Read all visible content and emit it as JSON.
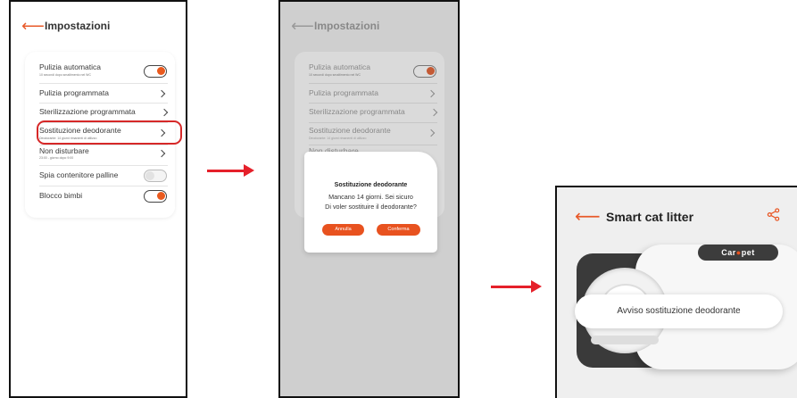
{
  "settings": {
    "title": "Impostazioni",
    "items": [
      {
        "label": "Pulizia automatica",
        "sub": "10 secondi dopo smaltimento nel WC",
        "control": "toggle-on"
      },
      {
        "label": "Pulizia programmata",
        "sub": "",
        "control": "chevron"
      },
      {
        "label": "Sterilizzazione programmata",
        "sub": "",
        "control": "chevron"
      },
      {
        "label": "Sostituzione deodorante",
        "sub": "Deodorante: 14 giorni rimanenti di utilizzo",
        "control": "chevron"
      },
      {
        "label": "Non disturbare",
        "sub": "23:00 - giorno dopo 9:00",
        "control": "chevron"
      },
      {
        "label": "Spia contenitore palline",
        "sub": "",
        "control": "toggle-off"
      },
      {
        "label": "Blocco bimbi",
        "sub": "",
        "control": "toggle-on"
      }
    ]
  },
  "dialog": {
    "title": "Sostituzione deodorante",
    "message_line1": "Mancano 14 giorni. Sei sicuro",
    "message_line2": "Di voler sostituire il deodorante?",
    "cancel_label": "Annulla",
    "confirm_label": "Conferma"
  },
  "device": {
    "title": "Smart cat litter",
    "brand": "Carepet",
    "brand_prefix": "Car",
    "brand_suffix": "pet",
    "notice": "Avviso sostituzione deodorante"
  },
  "colors": {
    "accent": "#e8521f",
    "highlight": "#d62828",
    "arrow": "#e5202a"
  },
  "icons": {
    "back": "back-arrow-icon",
    "share": "share-icon",
    "chevron": "chevron-right-icon"
  }
}
